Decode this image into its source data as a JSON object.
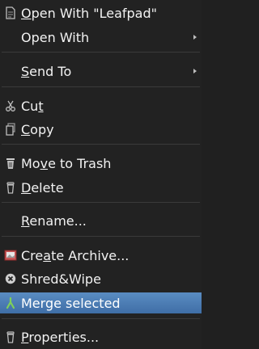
{
  "menu": {
    "items": [
      {
        "id": "open-with-leafpad",
        "label": "Open With \"Leafpad\"",
        "mnemonic_index": 0,
        "icon": "document-icon"
      },
      {
        "id": "open-with",
        "label": "Open With",
        "icon": "",
        "submenu": true
      },
      {
        "id": "send-to",
        "label": "Send To",
        "mnemonic_index": 0,
        "icon": "",
        "submenu": true
      },
      {
        "id": "cut",
        "label": "Cut",
        "mnemonic_index": 2,
        "icon": "scissors-icon"
      },
      {
        "id": "copy",
        "label": "Copy",
        "mnemonic_index": 0,
        "icon": "copy-icon"
      },
      {
        "id": "move-to-trash",
        "label": "Move to Trash",
        "mnemonic_index": 2,
        "icon": "trash-icon"
      },
      {
        "id": "delete",
        "label": "Delete",
        "mnemonic_index": 0,
        "icon": "delete-icon"
      },
      {
        "id": "rename",
        "label": "Rename...",
        "mnemonic_index": 0,
        "icon": ""
      },
      {
        "id": "create-archive",
        "label": "Create Archive...",
        "mnemonic_index": 3,
        "icon": "archive-icon"
      },
      {
        "id": "shred-wipe",
        "label": "Shred&Wipe",
        "icon": "shred-icon"
      },
      {
        "id": "merge-selected",
        "label": "Merge selected",
        "icon": "merge-icon",
        "selected": true
      },
      {
        "id": "properties",
        "label": "Properties...",
        "mnemonic_index": 0,
        "icon": "properties-icon"
      }
    ]
  },
  "colors": {
    "background": "#222222",
    "text": "#f2f2f2",
    "selection": "#4a7db5",
    "separator": "#3a3a3a"
  }
}
